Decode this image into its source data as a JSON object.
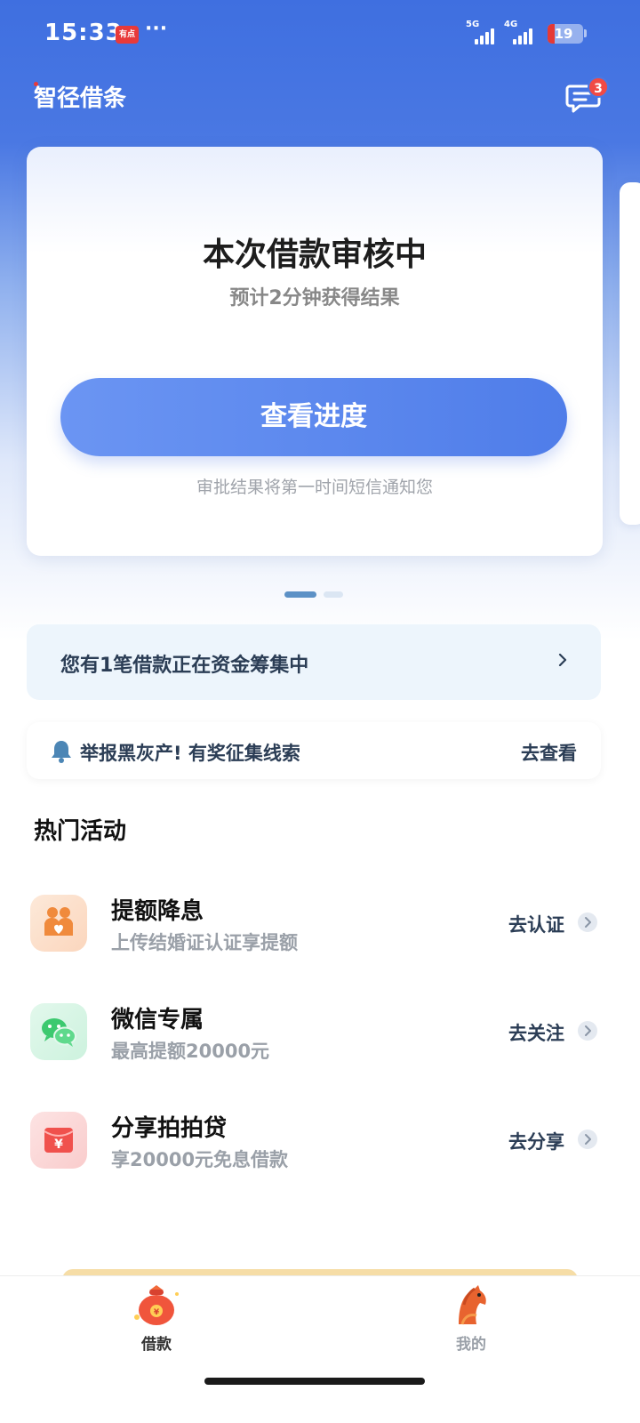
{
  "status_bar": {
    "time": "15:33",
    "app_badge": "有点",
    "more": "···",
    "network1": "5G",
    "network2": "4G",
    "battery": "19",
    "battery_level": 0.19
  },
  "header": {
    "title": "智径借条",
    "message_badge": "3"
  },
  "loan_card": {
    "title": "本次借款审核中",
    "subtitle": "预计2分钟获得结果",
    "button": "查看进度",
    "note": "审批结果将第一时间短信通知您"
  },
  "pager": {
    "total": 2,
    "active": 1
  },
  "funding_banner": {
    "text": "您有1笔借款正在资金筹集中"
  },
  "notice": {
    "text": "举报黑灰产! 有奖征集线索",
    "link": "去查看"
  },
  "section_title": "热门活动",
  "activities": [
    {
      "title": "提额降息",
      "subtitle": "上传结婚证认证享提额",
      "link": "去认证",
      "icon": "couple-icon"
    },
    {
      "title": "微信专属",
      "subtitle": "最高提额20000元",
      "link": "去关注",
      "icon": "wechat-icon"
    },
    {
      "title": "分享拍拍贷",
      "subtitle": "享20000元免息借款",
      "link": "去分享",
      "icon": "red-envelope-icon"
    }
  ],
  "tabbar": {
    "tabs": [
      {
        "label": "借款",
        "active": true,
        "icon": "money-bag-icon"
      },
      {
        "label": "我的",
        "active": false,
        "icon": "horse-icon"
      }
    ]
  },
  "colors": {
    "brand_blue": "#4a78e3",
    "button_blue": "#5a88ee",
    "badge_red": "#f04a45"
  }
}
